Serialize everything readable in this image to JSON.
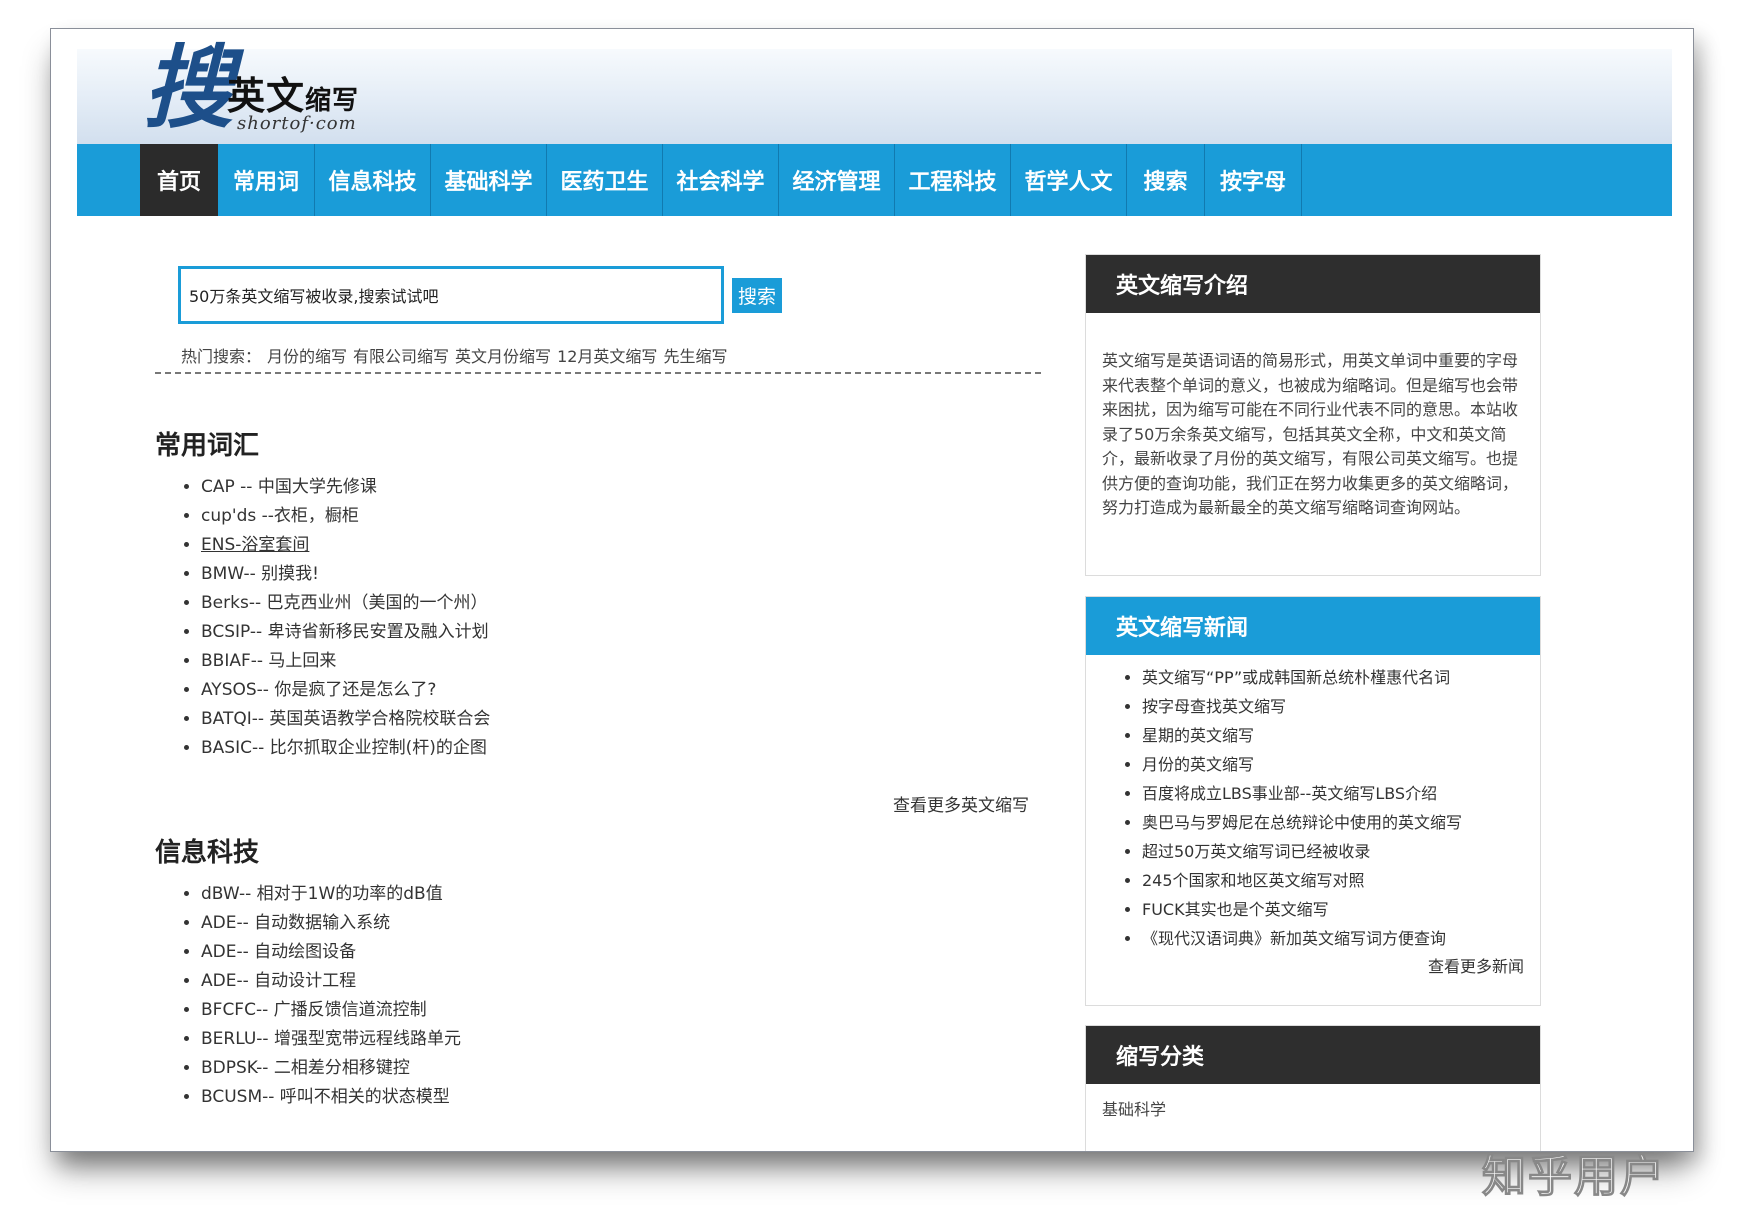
{
  "logo": {
    "mark": "搜",
    "title_main": "英文",
    "title_small": "缩写",
    "subtitle": "shortof·com"
  },
  "nav": [
    "首页",
    "常用词",
    "信息科技",
    "基础科学",
    "医药卫生",
    "社会科学",
    "经济管理",
    "工程科技",
    "哲学人文",
    "搜索",
    "按字母"
  ],
  "search": {
    "value": "50万条英文缩写被收录,搜索试试吧",
    "button": "搜索"
  },
  "hot": {
    "label": "热门搜索：",
    "items": [
      "月份的缩写",
      "有限公司缩写",
      "英文月份缩写",
      "12月英文缩写",
      "先生缩写"
    ]
  },
  "common": {
    "title": "常用词汇",
    "items": [
      "CAP -- 中国大学先修课",
      "cup'ds --衣柜，橱柜",
      "ENS-浴室套间",
      "BMW-- 别摸我!",
      "Berks-- 巴克西业州（美国的一个州）",
      "BCSIP-- 卑诗省新移民安置及融入计划",
      "BBIAF-- 马上回来",
      "AYSOS-- 你是疯了还是怎么了?",
      "BATQI-- 英国英语教学合格院校联合会",
      "BASIC-- 比尔抓取企业控制(杆)的企图"
    ],
    "more": "查看更多英文缩写"
  },
  "it": {
    "title": "信息科技",
    "items": [
      "dBW-- 相对于1W的功率的dB值",
      "ADE-- 自动数据输入系统",
      "ADE-- 自动绘图设备",
      "ADE-- 自动设计工程",
      "BFCFC-- 广播反馈信道流控制",
      "BERLU-- 增强型宽带远程线路单元",
      "BDPSK-- 二相差分相移键控",
      "BCUSM-- 呼叫不相关的状态模型"
    ]
  },
  "intro": {
    "title": "英文缩写介绍",
    "text": "英文缩写是英语词语的简易形式，用英文单词中重要的字母来代表整个单词的意义，也被成为缩略词。但是缩写也会带来困扰，因为缩写可能在不同行业代表不同的意思。本站收录了50万余条英文缩写，包括其英文全称，中文和英文简介，最新收录了月份的英文缩写，有限公司英文缩写。也提供方便的查询功能，我们正在努力收集更多的英文缩略词，努力打造成为最新最全的英文缩写缩略词查询网站。"
  },
  "news": {
    "title": "英文缩写新闻",
    "items": [
      "英文缩写“PP”或成韩国新总统朴槿惠代名词",
      "按字母查找英文缩写",
      "星期的英文缩写",
      "月份的英文缩写",
      "百度将成立LBS事业部--英文缩写LBS介绍",
      "奥巴马与罗姆尼在总统辩论中使用的英文缩写",
      "超过50万英文缩写词已经被收录",
      "245个国家和地区英文缩写对照",
      "FUCK其实也是个英文缩写",
      "《现代汉语词典》新加英文缩写词方便查询"
    ],
    "more": "查看更多新闻"
  },
  "categories": {
    "title": "缩写分类",
    "items": [
      "基础科学"
    ]
  },
  "watermark": "知乎用户"
}
